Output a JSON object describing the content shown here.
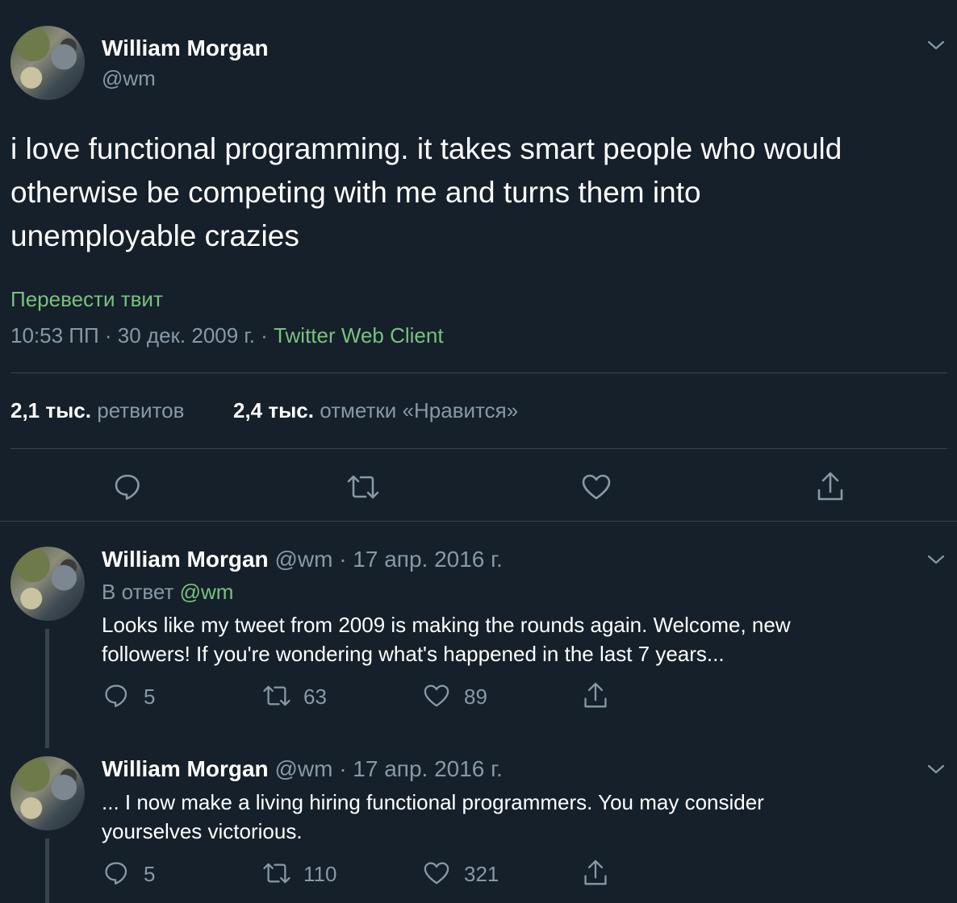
{
  "main_tweet": {
    "author_name": "William Morgan",
    "author_handle": "@wm",
    "text_lines": [
      "i love functional programming. it takes smart people who would",
      "otherwise be competing with me and turns them into",
      "unemployable crazies"
    ],
    "translate_label": "Перевести твит",
    "timestamp": "10:53 ПП · 30 дек. 2009 г. · ",
    "client": "Twitter Web Client",
    "retweets_count": "2,1 тыс.",
    "retweets_label": "ретвитов",
    "likes_count": "2,4 тыс.",
    "likes_label": "отметки «Нравится»",
    "actions": [
      "reply-icon",
      "retweet-icon",
      "like-icon",
      "share-icon"
    ]
  },
  "replies": [
    {
      "author_name": "William Morgan",
      "author_handle": "@wm",
      "separator": "·",
      "date": "17 апр. 2016 г.",
      "reply_prefix": "В ответ",
      "reply_to": "@wm",
      "text_lines": [
        "Looks like my tweet from 2009 is making the rounds again. Welcome, new",
        "followers! If you're wondering what's happened in the last 7 years..."
      ],
      "reply_count": "5",
      "retweet_count": "63",
      "like_count": "89"
    },
    {
      "author_name": "William Morgan",
      "author_handle": "@wm",
      "separator": "·",
      "date": "17 апр. 2016 г.",
      "text_lines": [
        "... I now make a living hiring functional programmers. You may consider",
        "yourselves victorious."
      ],
      "reply_count": "5",
      "retweet_count": "110",
      "like_count": "321"
    }
  ],
  "colors": {
    "background": "#15202b",
    "text": "#ffffff",
    "muted": "#8899a6",
    "accent_green": "#79c27d",
    "divider": "#38444d"
  }
}
